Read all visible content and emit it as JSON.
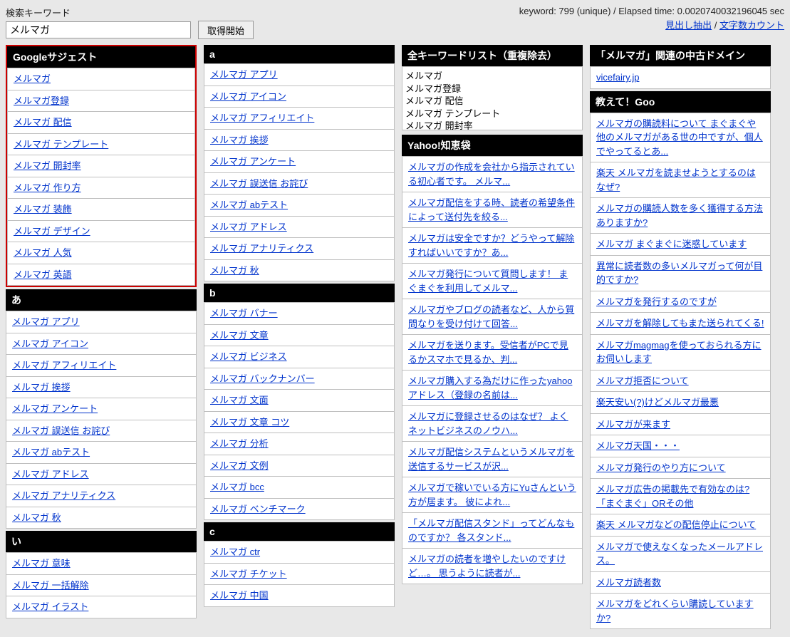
{
  "search": {
    "label": "検索キーワード",
    "value": "メルマガ",
    "button": "取得開始"
  },
  "status": {
    "line": "keyword: 799 (unique) / Elapsed time: 0.0020740032196045 sec",
    "link1": "見出し抽出",
    "link2": "文字数カウント",
    "sep": " / "
  },
  "col1": {
    "google": {
      "title": "Googleサジェスト",
      "items": [
        "メルマガ",
        "メルマガ登録",
        "メルマガ 配信",
        "メルマガ テンプレート",
        "メルマガ 開封率",
        "メルマガ 作り方",
        "メルマガ 装飾",
        "メルマガ デザイン",
        "メルマガ 人気",
        "メルマガ 英語"
      ]
    },
    "a": {
      "title": "あ",
      "items": [
        "メルマガ アプリ",
        "メルマガ アイコン",
        "メルマガ アフィリエイト",
        "メルマガ 挨拶",
        "メルマガ アンケート",
        "メルマガ 誤送信 お詫び",
        "メルマガ abテスト",
        "メルマガ アドレス",
        "メルマガ アナリティクス",
        "メルマガ 秋"
      ]
    },
    "i": {
      "title": "い",
      "items": [
        "メルマガ 意味",
        "メルマガ 一括解除",
        "メルマガ イラスト"
      ]
    }
  },
  "col2": {
    "la": {
      "title": "a",
      "items": [
        "メルマガ アプリ",
        "メルマガ アイコン",
        "メルマガ アフィリエイト",
        "メルマガ 挨拶",
        "メルマガ アンケート",
        "メルマガ 誤送信 お詫び",
        "メルマガ abテスト",
        "メルマガ アドレス",
        "メルマガ アナリティクス",
        "メルマガ 秋"
      ]
    },
    "lb": {
      "title": "b",
      "items": [
        "メルマガ バナー",
        "メルマガ 文章",
        "メルマガ ビジネス",
        "メルマガ バックナンバー",
        "メルマガ 文面",
        "メルマガ 文章 コツ",
        "メルマガ 分析",
        "メルマガ 文例",
        "メルマガ bcc",
        "メルマガ ベンチマーク"
      ]
    },
    "lc": {
      "title": "c",
      "items": [
        "メルマガ ctr",
        "メルマガ チケット",
        "メルマガ 中国"
      ]
    }
  },
  "col3": {
    "all": {
      "title": "全キーワードリスト（重複除去）",
      "text": "メルマガ\nメルマガ登録\nメルマガ 配信\nメルマガ テンプレート\nメルマガ 開封率"
    },
    "yahoo": {
      "title": "Yahoo!知恵袋",
      "items": [
        "メルマガの作成を会社から指示されている初心者です。 メルマ...",
        "メルマガ配信をする時、読者の希望条件によって送付先を絞る...",
        "メルマガは安全ですか？どうやって解除すればいいですか？あ...",
        "メルマガ発行について質問します！ まぐまぐを利用してメルマ...",
        "メルマガやブログの読者など、人から質問なりを受け付けて回答...",
        "メルマガを送ります。受信者がPCで見るかスマホで見るか、判...",
        "メルマガ購入する為だけに作ったyahooアドレス（登録の名前は...",
        "メルマガに登録させるのはなぜ？ よくネットビジネスのノウハ...",
        "メルマガ配信システムというメルマガを送信するサービスが沢...",
        "メルマガで稼いでいる方にYuさんという方が居ます。 彼によれ...",
        "「メルマガ配信スタンド」ってどんなものですか？ 各スタンド...",
        "メルマガの読者を増やしたいのですけど…。 思うように読者が..."
      ]
    }
  },
  "col4": {
    "domains": {
      "title": "「メルマガ」関連の中古ドメイン",
      "items": [
        "vicefairy.jp"
      ]
    },
    "goo": {
      "title": "教えて！Goo",
      "items": [
        "メルマガの購読料について まぐまぐや他のメルマガがある世の中ですが、個人でやってるとあ...",
        "楽天 メルマガを読ませようとするのはなぜ?",
        "メルマガの購読人数を多く獲得する方法ありますか?",
        "メルマガ まぐまぐに迷惑しています",
        "異常に読者数の多いメルマガって何が目的ですか?",
        "メルマガを発行するのですが",
        "メルマガを解除してもまた送られてくる!",
        "メルマガmagmagを使っておられる方にお伺いします",
        "メルマガ拒否について",
        "楽天安い(?)けどメルマガ最悪",
        "メルマガが来ます",
        "メルマガ天国・・・",
        "メルマガ発行のやり方について",
        "メルマガ広告の掲載先で有効なのは?「まぐまぐ」ORその他",
        "楽天 メルマガなどの配信停止について",
        "メルマガで使えなくなったメールアドレス。",
        "メルマガ読者数",
        "メルマガをどれくらい購読していますか?"
      ]
    }
  }
}
